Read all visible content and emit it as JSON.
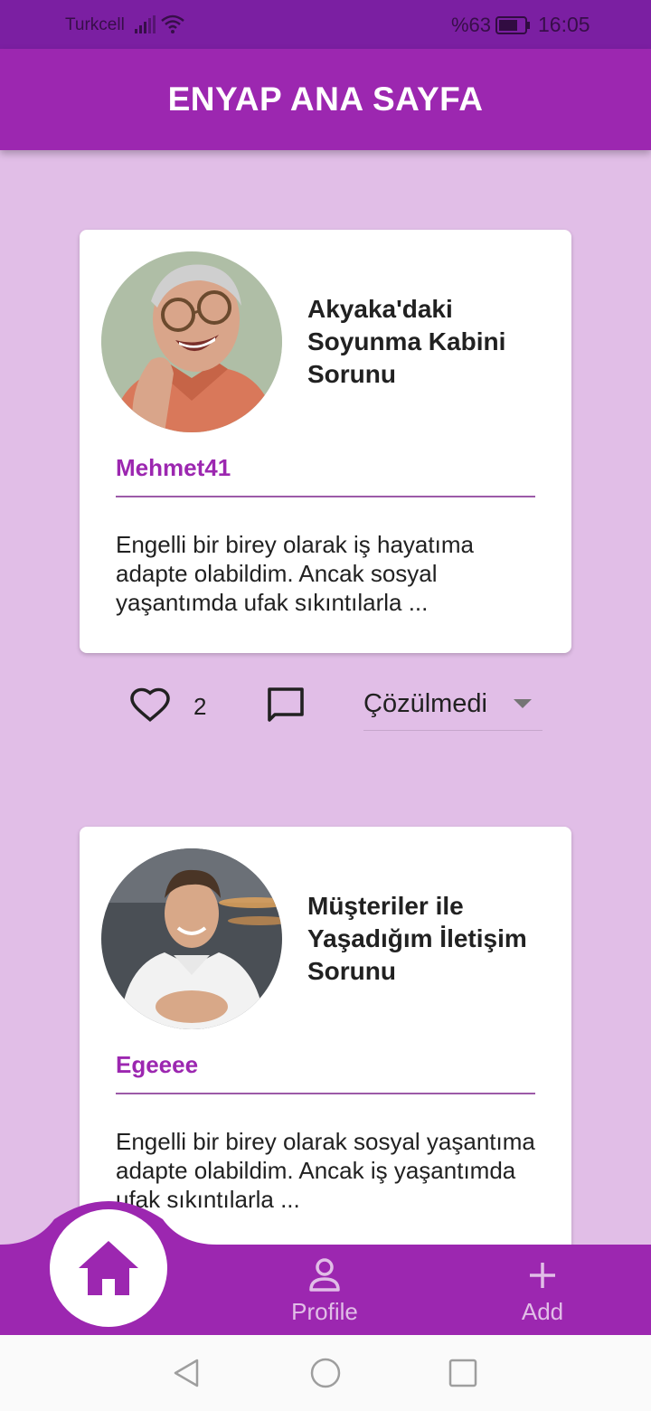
{
  "status_bar": {
    "carrier": "Turkcell",
    "battery": "%63",
    "time": "16:05"
  },
  "app_bar": {
    "title": "ENYAP ANA SAYFA"
  },
  "posts": [
    {
      "title": "Akyaka'daki Soyunma Kabini Sorunu",
      "username": "Mehmet41",
      "excerpt": "Engelli bir birey olarak iş hayatıma adapte olabildim. Ancak sosyal yaşantımda ufak sıkıntılarla ...",
      "likes": "2",
      "status": "Çözülmedi"
    },
    {
      "title": "Müşteriler ile Yaşadığım İletişim Sorunu",
      "username": "Egeeee",
      "excerpt": "Engelli bir birey olarak sosyal yaşantıma adapte olabildim. Ancak iş yaşantımda ufak sıkıntılarla ..."
    }
  ],
  "bottom_nav": {
    "items": [
      {
        "label": "Home",
        "icon": "home-icon"
      },
      {
        "label": "Profile",
        "icon": "person-icon"
      },
      {
        "label": "Add",
        "icon": "plus-icon"
      }
    ]
  },
  "colors": {
    "primary": "#9c27b0",
    "status_bar": "#7b1fa2",
    "background": "#e1bee7"
  }
}
